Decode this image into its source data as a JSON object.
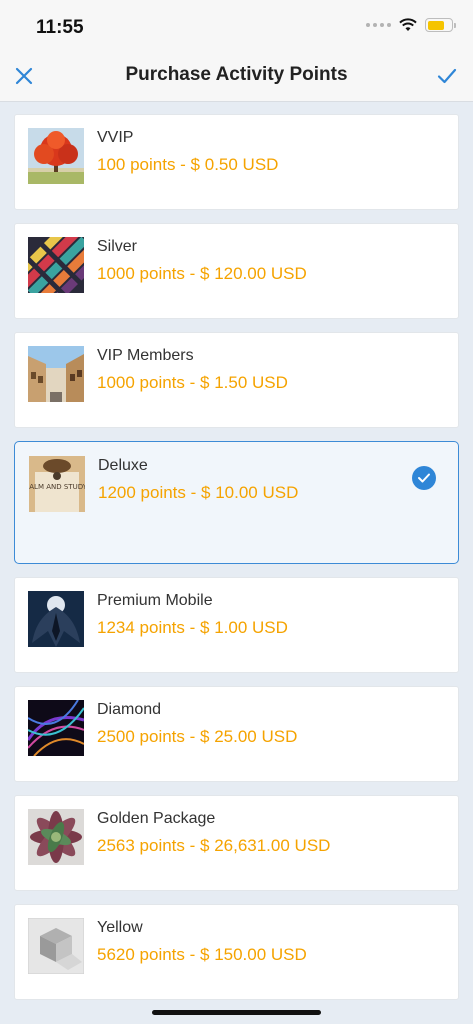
{
  "status": {
    "time": "11:55"
  },
  "nav": {
    "title": "Purchase Activity Points",
    "close_icon": "close-icon",
    "done_icon": "checkmark-icon"
  },
  "colors": {
    "accent": "#2f86d7",
    "price": "#f5a300"
  },
  "items": [
    {
      "name": "VVIP",
      "price": "100 points - $ 0.50 USD",
      "thumb": "tree"
    },
    {
      "name": "Silver",
      "price": "1000 points - $ 120.00 USD",
      "thumb": "tiles"
    },
    {
      "name": "VIP Members",
      "price": "1000 points - $ 1.50 USD",
      "thumb": "street"
    },
    {
      "name": "Deluxe",
      "price": "1200 points - $ 10.00 USD",
      "thumb": "keep-calm",
      "selected": true
    },
    {
      "name": "Premium Mobile",
      "price": "1234 points - $ 1.00 USD",
      "thumb": "winged-figure"
    },
    {
      "name": "Diamond",
      "price": "2500 points - $ 25.00 USD",
      "thumb": "neon-lines"
    },
    {
      "name": "Golden Package",
      "price": "2563 points - $ 26,631.00 USD",
      "thumb": "succulent"
    },
    {
      "name": "Yellow",
      "price": "5620 points - $ 150.00 USD",
      "thumb": "placeholder-box"
    }
  ],
  "thumb_text": {
    "keep_calm": "KEEP CALM AND STUDY HARD"
  }
}
